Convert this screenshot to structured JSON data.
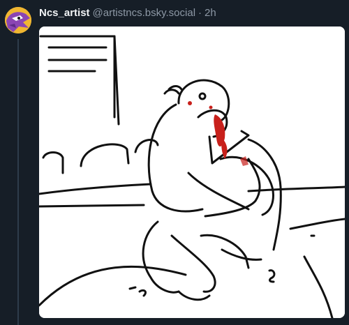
{
  "post": {
    "author": {
      "display_name": "Ncs_artist",
      "handle": "@artistncs.bsky.social",
      "avatar_icon": "purple-character-avatar-icon"
    },
    "separator": "·",
    "timestamp": "2h",
    "media": {
      "kind": "image",
      "icon": "wrestling-sketch-image"
    }
  },
  "colors": {
    "background": "#161e27",
    "thread_line": "#2e3c4b",
    "name_text": "#f1f3f5",
    "meta_text": "#8d98a5",
    "blood_accent": "#c8201b"
  }
}
